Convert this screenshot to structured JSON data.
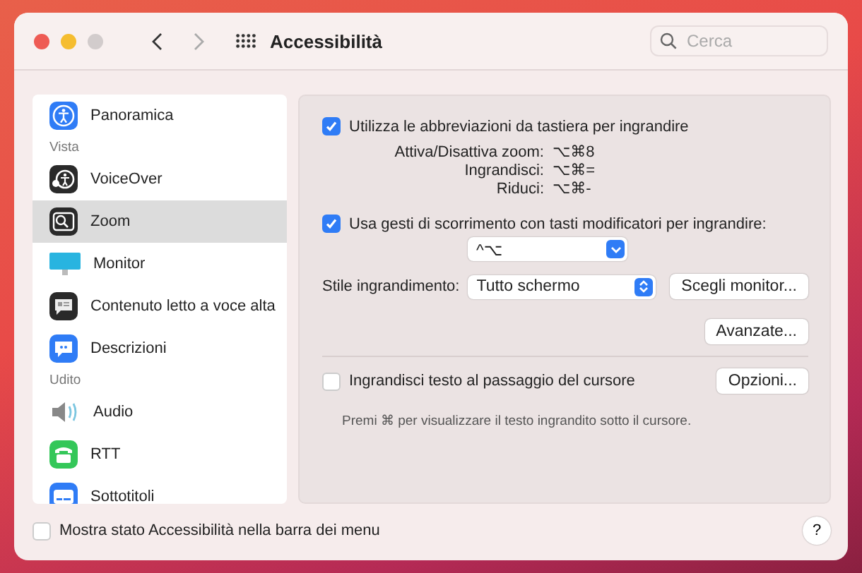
{
  "window": {
    "title": "Accessibilità",
    "search": {
      "placeholder": "Cerca"
    }
  },
  "sidebar": {
    "items": [
      {
        "kind": "item",
        "label": "Panoramica",
        "selected": false
      },
      {
        "kind": "section",
        "label": "Vista"
      },
      {
        "kind": "item",
        "label": "VoiceOver",
        "selected": false
      },
      {
        "kind": "item",
        "label": "Zoom",
        "selected": true
      },
      {
        "kind": "item",
        "label": "Monitor",
        "selected": false
      },
      {
        "kind": "item",
        "label": "Contenuto letto a voce alta",
        "selected": false
      },
      {
        "kind": "item",
        "label": "Descrizioni",
        "selected": false
      },
      {
        "kind": "section",
        "label": "Udito"
      },
      {
        "kind": "item",
        "label": "Audio",
        "selected": false
      },
      {
        "kind": "item",
        "label": "RTT",
        "selected": false
      },
      {
        "kind": "item",
        "label": "Sottotitoli",
        "selected": false
      }
    ]
  },
  "panel": {
    "shortcuts_option": {
      "label": "Utilizza le abbreviazioni da tastiera per ingrandire",
      "checked": true
    },
    "shortcuts": [
      {
        "label": "Attiva/Disattiva zoom:",
        "keys": "⌥⌘8"
      },
      {
        "label": "Ingrandisci:",
        "keys": "⌥⌘="
      },
      {
        "label": "Riduci:",
        "keys": "⌥⌘-"
      }
    ],
    "scroll_option": {
      "label": "Usa gesti di scorrimento con tasti modificatori per ingrandire:",
      "checked": true
    },
    "modifier_select": {
      "value": "^⌥"
    },
    "style": {
      "label": "Stile ingrandimento:",
      "value": "Tutto schermo"
    },
    "choose_monitor_button": "Scegli monitor...",
    "advanced_button": "Avanzate...",
    "hover_option": {
      "label": "Ingrandisci testo al passaggio del cursore",
      "checked": false
    },
    "options_button": "Opzioni...",
    "hover_hint": "Premi ⌘ per visualizzare il testo ingrandito sotto il cursore."
  },
  "footer": {
    "menu_bar_option": {
      "label": "Mostra stato Accessibilità nella barra dei menu",
      "checked": false
    },
    "help": "?"
  }
}
